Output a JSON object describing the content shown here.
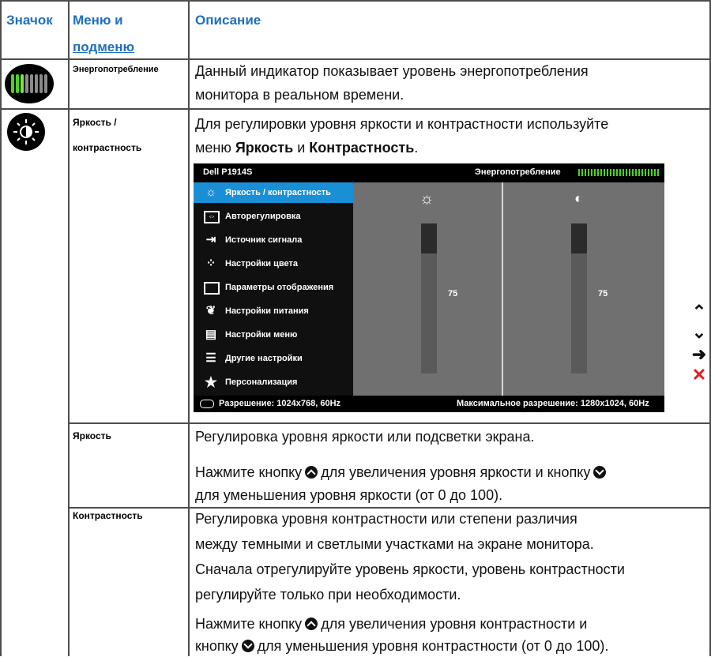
{
  "header": {
    "icon": "Значок",
    "menu_line1": "Меню и",
    "menu_line2": "подменю",
    "description": "Описание"
  },
  "rows": {
    "power": {
      "icon": "power-meter-icon",
      "name": "Энергопотребление",
      "desc_line1": "Данный индикатор показывает уровень энергопотребления",
      "desc_line2": "монитора в реальном времени."
    },
    "brightness_contrast": {
      "icon": "brightness-contrast-icon",
      "name_line1": "Яркость /",
      "name_line2": "контрастность",
      "desc_line1": "Для регулировки уровня яркости и контрастности используйте",
      "desc_prefix": "меню ",
      "desc_b1": "Яркость",
      "desc_and": " и ",
      "desc_b2": "Контрастность",
      "desc_end": "."
    },
    "brightness": {
      "name": "Яркость",
      "desc_line1": "Регулировка уровня яркости или подсветки экрана.",
      "desc2_a": "Нажмите кнопку",
      "desc2_b": "для увеличения уровня яркости и кнопку",
      "desc2_line2": "для уменьшения уровня яркости (от 0 до 100)."
    },
    "contrast": {
      "name": "Контрастность",
      "desc_line1": "Регулировка уровня контрастности или степени различия",
      "desc_line2": "между темными и светлыми участками на экране монитора.",
      "desc_line3": "Сначала отрегулируйте уровень яркости, уровень контрастности",
      "desc_line4": "регулируйте только при необходимости.",
      "desc5_line1": "Нажмите кнопку",
      "desc5_line1b": "для увеличения уровня контрастности и",
      "desc5_line2a": "кнопку",
      "desc5_line2b": "для уменьшения уровня контрастности (от 0 до 100)."
    }
  },
  "osd": {
    "model": "Dell P1914S",
    "power_label": "Энергопотребление",
    "menu": [
      {
        "icon": "sun-icon",
        "label": "Яркость / контрастность",
        "selected": true
      },
      {
        "icon": "auto-adjust-icon",
        "label": "Авторегулировка"
      },
      {
        "icon": "input-source-icon",
        "label": "Источник сигнала"
      },
      {
        "icon": "color-settings-icon",
        "label": "Настройки цвета"
      },
      {
        "icon": "display-settings-icon",
        "label": "Параметры отображения"
      },
      {
        "icon": "power-settings-icon",
        "label": "Настройки питания"
      },
      {
        "icon": "menu-settings-icon",
        "label": "Настройки меню"
      },
      {
        "icon": "other-settings-icon",
        "label": "Другие настройки"
      },
      {
        "icon": "star-icon",
        "label": "Персонализация"
      }
    ],
    "brightness_value": "75",
    "contrast_value": "75",
    "brightness_level": 0.75,
    "contrast_level": 0.75,
    "resolution": "Разрешение: 1024x768,  60Hz",
    "max_resolution": "Максимальное разрешение: 1280x1024,  60Hz",
    "accent": "#1a8fd6"
  },
  "nav_buttons": {
    "up": "up-arrow-icon",
    "down": "down-arrow-icon",
    "enter": "right-arrow-icon",
    "exit": "close-icon"
  }
}
